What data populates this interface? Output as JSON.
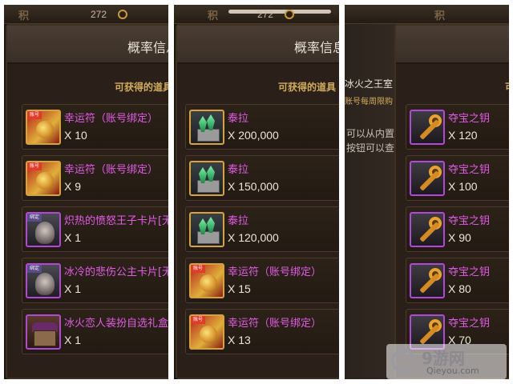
{
  "panels": [
    {
      "top_icon": "积",
      "currency": "272",
      "dialog_title": "概率信息",
      "section_label": "可获得的道具",
      "items": [
        {
          "name": "幸运符（账号绑定）",
          "qty": "X 10",
          "icon": "lucky-charm-icon"
        },
        {
          "name": "幸运符（账号绑定）",
          "qty": "X 9",
          "icon": "lucky-charm-icon"
        },
        {
          "name": "炽热的愤怒王子卡片[无",
          "qty": "X 1",
          "icon": "prince-card-icon"
        },
        {
          "name": "冰冷的悲伤公主卡片[无",
          "qty": "X 1",
          "icon": "princess-card-icon"
        },
        {
          "name": "冰火恋人装扮自选礼盒",
          "qty": "X 1",
          "icon": "gift-box-icon"
        }
      ]
    },
    {
      "top_icon": "积",
      "currency": "272",
      "dialog_title": "概率信息",
      "section_label": "可获得的道具",
      "items": [
        {
          "name": "泰拉",
          "qty": "X 200,000",
          "icon": "terra-crystal-icon"
        },
        {
          "name": "泰拉",
          "qty": "X 150,000",
          "icon": "terra-crystal-icon"
        },
        {
          "name": "泰拉",
          "qty": "X 120,000",
          "icon": "terra-crystal-icon"
        },
        {
          "name": "幸运符（账号绑定）",
          "qty": "X 15",
          "icon": "lucky-charm-icon"
        },
        {
          "name": "幸运符（账号绑定）",
          "qty": "X 13",
          "icon": "lucky-charm-icon"
        }
      ]
    },
    {
      "top_icon": "积",
      "back_title": "冰火之王室",
      "back_subtitle": "账号每周限购",
      "back_line1": "可以从内置",
      "back_line2": "按钮可以查",
      "right_fragment": "可",
      "items": [
        {
          "name": "夺宝之钥",
          "qty": "X 120",
          "icon": "treasure-key-icon"
        },
        {
          "name": "夺宝之钥",
          "qty": "X 100",
          "icon": "treasure-key-icon"
        },
        {
          "name": "夺宝之钥",
          "qty": "X 90",
          "icon": "treasure-key-icon"
        },
        {
          "name": "夺宝之钥",
          "qty": "X 80",
          "icon": "treasure-key-icon"
        },
        {
          "name": "夺宝之钥",
          "qty": "X 70",
          "icon": "treasure-key-icon"
        }
      ]
    }
  ],
  "watermark": {
    "cn": "9游网",
    "en": "Qieyou.com"
  },
  "colors": {
    "item_name": "#e35be6",
    "section_label": "#d2ac5c",
    "quantity": "#ece6da"
  }
}
